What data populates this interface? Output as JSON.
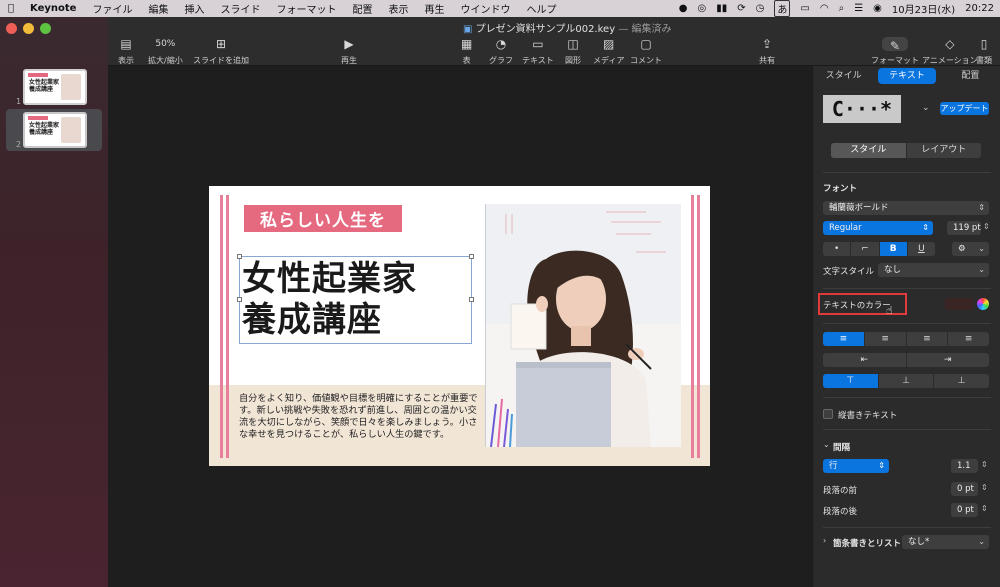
{
  "menubar": {
    "apple": "",
    "app_name": "Keynote",
    "items": [
      "ファイル",
      "編集",
      "挿入",
      "スライド",
      "フォーマット",
      "配置",
      "表示",
      "再生",
      "ウインドウ",
      "ヘルプ"
    ],
    "date": "10月23日(水)",
    "time": "20:22",
    "input_indicator": "あ"
  },
  "window": {
    "doc_title": "プレゼン資料サンプル002.key",
    "doc_status": "— 編集済み"
  },
  "toolbar": {
    "view": "表示",
    "zoom_value": "50%",
    "zoom": "拡大/縮小",
    "add_slide": "スライドを追加",
    "play": "再生",
    "table": "表",
    "chart": "グラフ",
    "text": "テキスト",
    "shape": "図形",
    "media": "メディア",
    "comment": "コメント",
    "share": "共有",
    "format": "フォーマット",
    "animate": "アニメーション",
    "document": "書類"
  },
  "slides": [
    {
      "number": "1",
      "thumb_title": "女性起業家\n養成講座"
    },
    {
      "number": "2",
      "thumb_title": "女性起業家\n養成講座"
    }
  ],
  "slide": {
    "tag": "私らしい人生を",
    "title_line1": "女性起業家",
    "title_line2": "養成講座",
    "body": "自分をよく知り、価値観や目標を明確にすることが重要です。新しい挑戦や失敗を恐れず前進し、周囲との温かい交流を大切にしながら、笑顔で日々を楽しみましょう。小さな幸せを見つけることが、私らしい人生の鍵です。"
  },
  "inspector": {
    "tabs": [
      "スタイル",
      "テキスト",
      "配置"
    ],
    "active_tab": "テキスト",
    "style_preview": "C···*",
    "update_button": "アップデート",
    "sub_tabs": [
      "スタイル",
      "レイアウト"
    ],
    "font_section": "フォント",
    "font_family": "輔蘭薇ボールド",
    "font_style": "Regular",
    "font_size": "119 pt",
    "format_buttons": [
      "•",
      "⌐",
      "B",
      "U"
    ],
    "char_style_label": "文字スタイル",
    "char_style_value": "なし",
    "text_color_label": "テキストのカラー",
    "vertical_text": "縦書きテキスト",
    "spacing_section": "間隔",
    "line_mode": "行",
    "line_value": "1.1",
    "before_para": "段落の前",
    "before_value": "0 pt",
    "after_para": "段落の後",
    "after_value": "0 pt",
    "bullets_label": "箇条書きとリスト",
    "bullets_value": "なし*"
  },
  "colors": {
    "accent": "#0a74df",
    "slide_pink": "#e5697f",
    "highlight_box": "#e03a3a"
  }
}
